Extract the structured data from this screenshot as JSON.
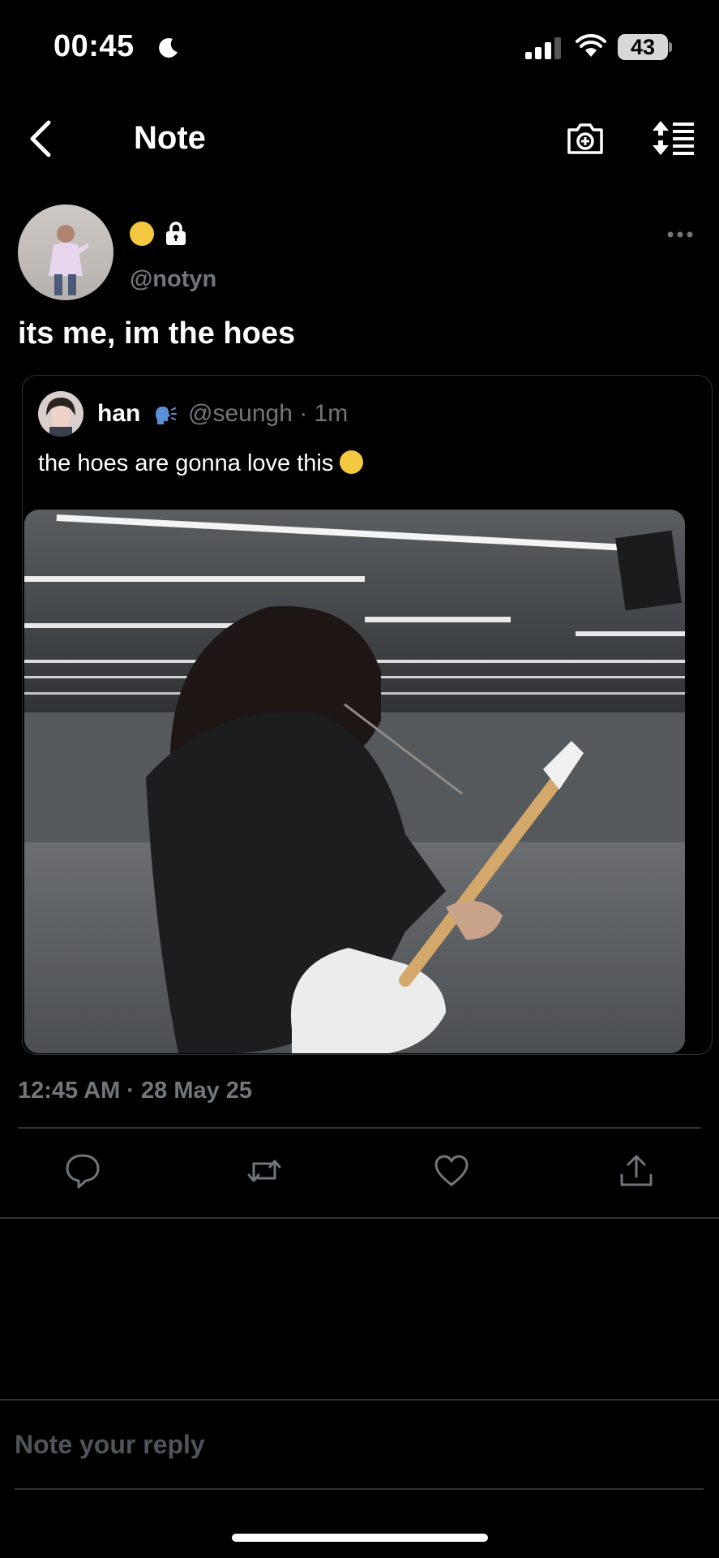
{
  "status_bar": {
    "time": "00:45",
    "battery": "43"
  },
  "header": {
    "title": "Note"
  },
  "post": {
    "handle": "@notyn",
    "text": "its me, im the hoes",
    "timestamp": "12:45 AM · 28 May 25"
  },
  "quote": {
    "name": "han",
    "meta": "@seungh · 1m",
    "text": "the hoes are gonna love this"
  },
  "reply": {
    "placeholder": "Note your reply"
  },
  "icons": {
    "moon": "moon-icon",
    "signal": "signal-icon",
    "wifi": "wifi-icon",
    "battery": "battery-icon",
    "back": "chevron-left-icon",
    "camera": "camera-plus-icon",
    "sort": "sort-list-icon",
    "lock": "lock-icon",
    "more": "more-horizontal-icon",
    "speak": "speaking-head-icon",
    "reply": "reply-icon",
    "retweet": "retweet-icon",
    "like": "heart-icon",
    "share": "share-icon"
  },
  "colors": {
    "background": "#000000",
    "text": "#e7e9ea",
    "secondary": "#71767b",
    "divider": "#2f3336"
  }
}
